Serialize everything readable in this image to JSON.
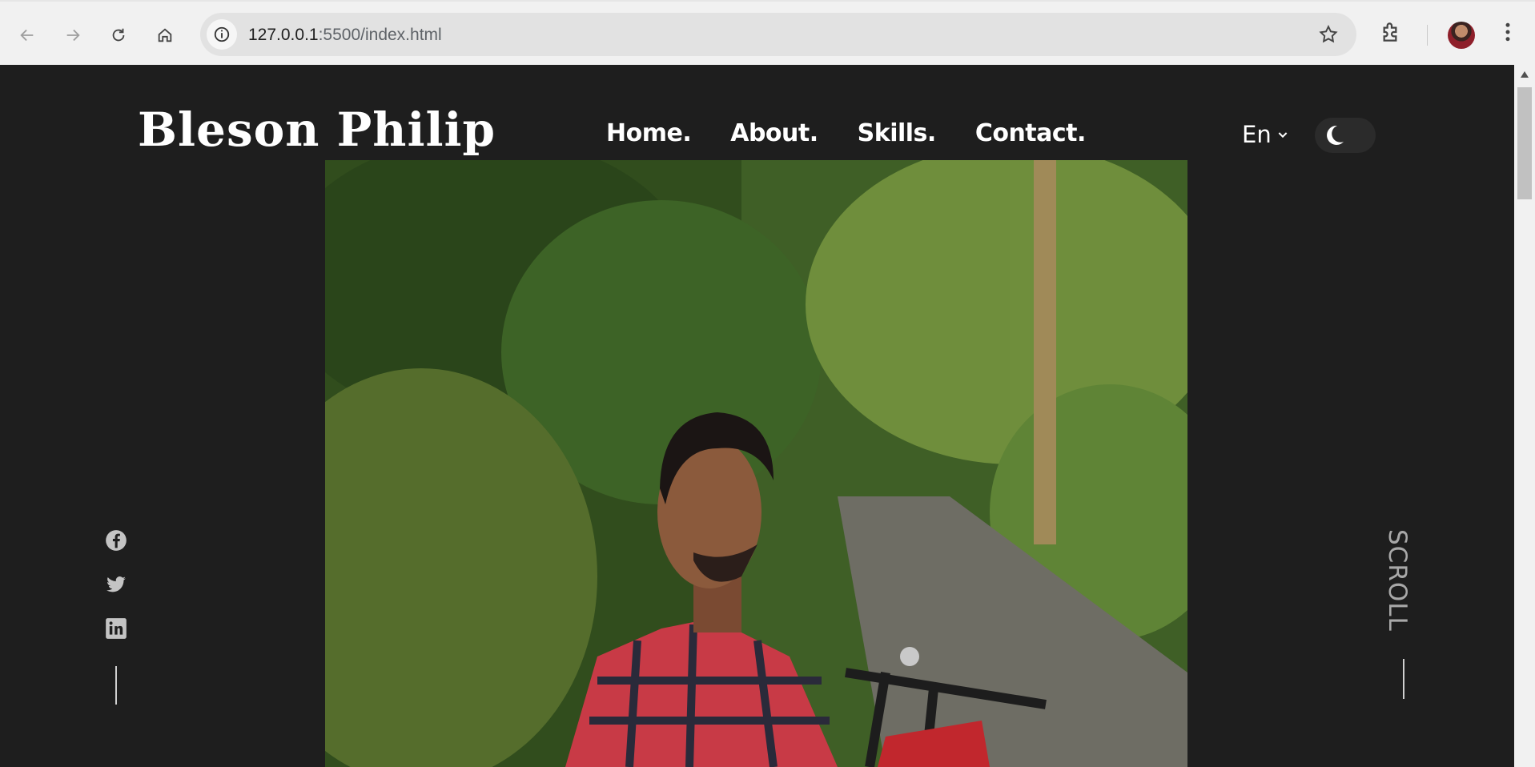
{
  "browser": {
    "url_host": "127.0.0.1",
    "url_path": ":5500/index.html"
  },
  "site": {
    "logo": "Bleson Philip",
    "nav": [
      "Home.",
      "About.",
      "Skills.",
      "Contact."
    ],
    "language": "En",
    "scroll_label": "SCROLL"
  },
  "icons": {
    "social": [
      "facebook-icon",
      "twitter-icon",
      "linkedin-icon"
    ],
    "theme_toggle": "moon-icon"
  },
  "colors": {
    "page_background": "#1e1e1e",
    "text": "#ffffff",
    "scroll_text": "#a8a8a8"
  }
}
